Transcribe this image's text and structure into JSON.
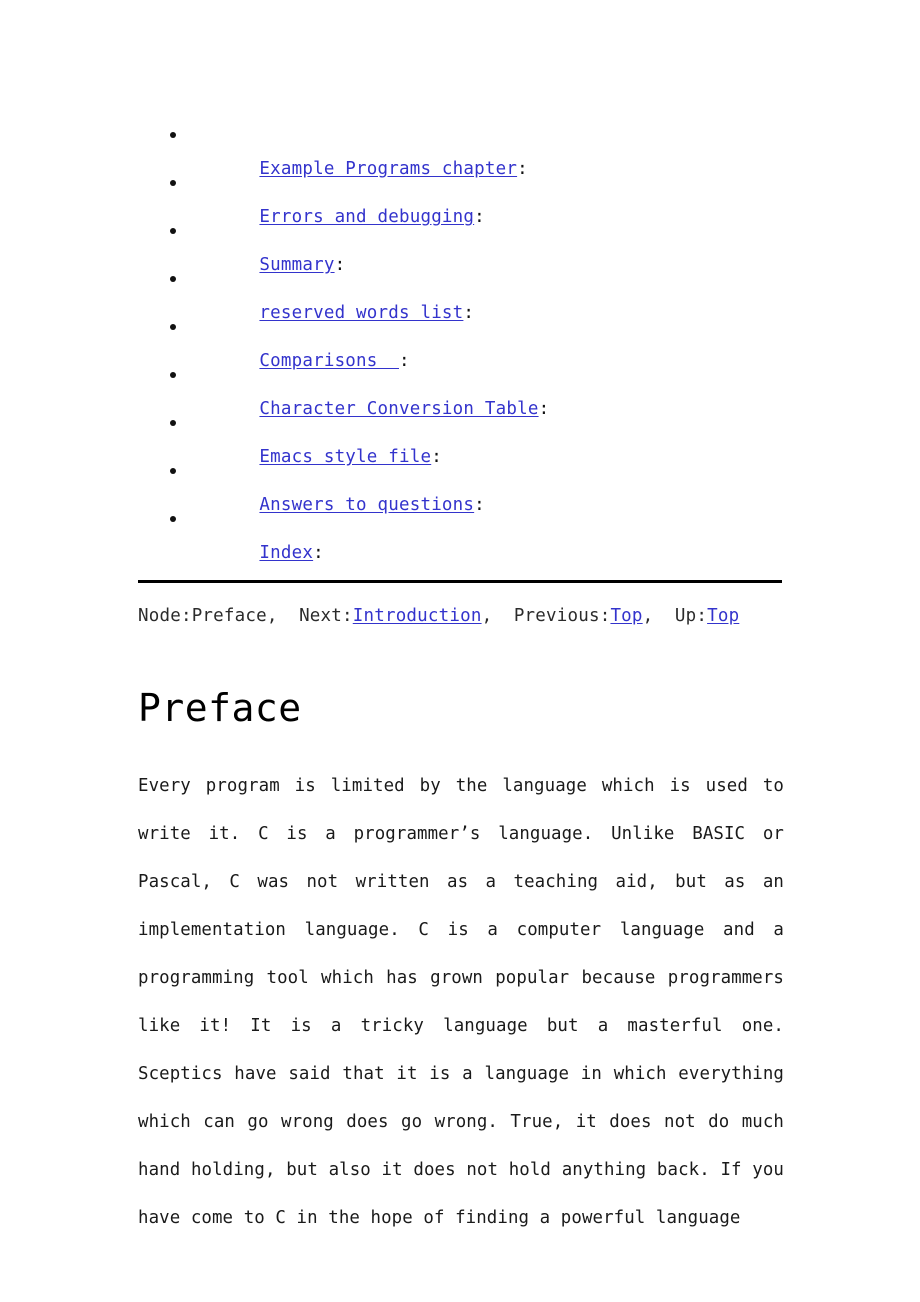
{
  "document": {
    "title": "Preface",
    "link_color": "#3333cc",
    "text_color": "#1a1a1a"
  },
  "menu": {
    "items": [
      {
        "label": "Example Programs chapter",
        "suffix": ":"
      },
      {
        "label": "Errors and debugging",
        "suffix": ":"
      },
      {
        "label": "Summary",
        "suffix": ":"
      },
      {
        "label": "reserved words list",
        "suffix": ":"
      },
      {
        "label": "Comparisons  ",
        "suffix": ":"
      },
      {
        "label": "Character Conversion Table",
        "suffix": ":"
      },
      {
        "label": "Emacs style file",
        "suffix": ":"
      },
      {
        "label": "Answers to questions",
        "suffix": ":"
      },
      {
        "label": "Index",
        "suffix": ":"
      }
    ]
  },
  "nav": {
    "node_label": "Node:",
    "node_value": "Preface",
    "sep1": ",  ",
    "next_label": "Next:",
    "next_link": "Introduction",
    "sep2": ",  ",
    "previous_label": "Previous:",
    "previous_link": "Top",
    "sep3": ",  ",
    "up_label": "Up:",
    "up_link": "Top"
  },
  "heading": {
    "text": "Preface"
  },
  "content": {
    "paragraph": "Every program is limited by the language which is used to write it. C is a programmer’s language. Unlike BASIC or Pascal, C was not written as a teaching aid, but as an implementation language. C is a computer language and a programming tool which has grown popular because programmers like it! It is a tricky language but a masterful one. Sceptics have said that it is a language in which everything which can go wrong does go wrong. True, it does not do much hand holding, but also it does not hold anything back. If you have come to C in the hope of finding a powerful language"
  }
}
